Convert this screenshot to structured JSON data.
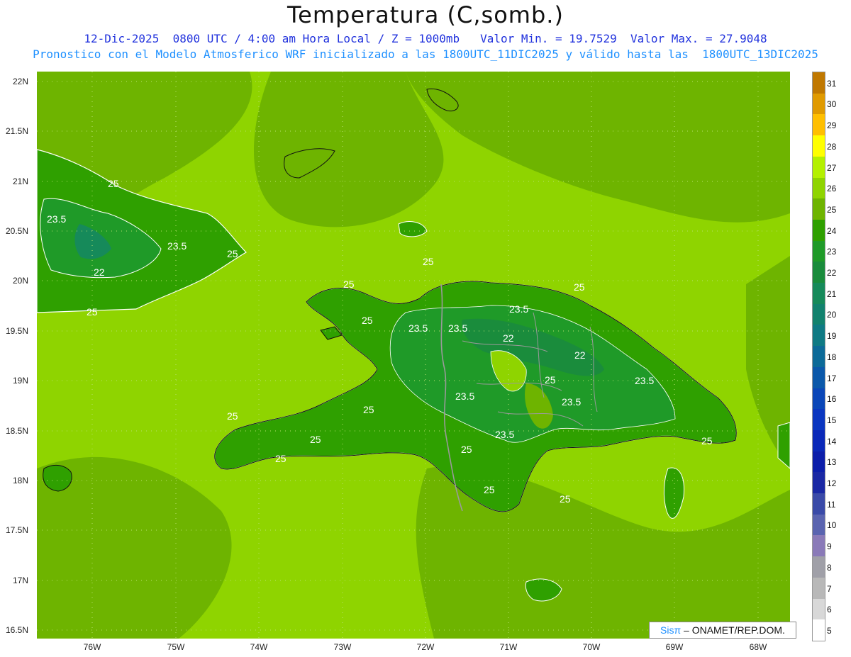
{
  "title": "Temperatura (C,somb.)",
  "subtitle1": "12-Dic-2025  0800 UTC / 4:00 am Hora Local / Z = 1000mb   Valor Min. = 19.7529  Valor Max. = 27.9048",
  "subtitle2": "Pronostico con el Modelo Atmosferico WRF inicializado a las 1800UTC_11DIC2025 y válido hasta las  1800UTC_13DIC2025",
  "lat_labels": [
    "22N",
    "21.5N",
    "21N",
    "20.5N",
    "20N",
    "19.5N",
    "19N",
    "18.5N",
    "18N",
    "17.5N",
    "17N",
    "16.5N"
  ],
  "lon_labels": [
    "76W",
    "75W",
    "74W",
    "73W",
    "72W",
    "71W",
    "70W",
    "69W",
    "68W"
  ],
  "colorbar": {
    "labels": [
      "31",
      "30",
      "29",
      "28",
      "27",
      "26",
      "25",
      "24",
      "23",
      "22",
      "21",
      "20",
      "19",
      "18",
      "17",
      "16",
      "15",
      "14",
      "13",
      "12",
      "11",
      "10",
      "9",
      "8",
      "7",
      "6",
      "5"
    ],
    "colors": [
      "#c07800",
      "#e09a00",
      "#ffbf00",
      "#ffff00",
      "#b4f000",
      "#8fd400",
      "#6eb400",
      "#2fa000",
      "#1f9a28",
      "#1a8c3c",
      "#168a5a",
      "#12826e",
      "#0f7a84",
      "#0c6a98",
      "#0b58aa",
      "#0a46b8",
      "#0a36c0",
      "#0a28b8",
      "#0c1eaa",
      "#1a28a4",
      "#3a4aa8",
      "#5a64b0",
      "#8a7ab8",
      "#a0a0a8",
      "#b8b8b8",
      "#d8d8d8",
      "#ffffff"
    ]
  },
  "contour_labels": [
    "25",
    "23.5",
    "22",
    "25",
    "23.5",
    "25",
    "25",
    "25",
    "23.5",
    "23.5",
    "22",
    "23.5",
    "22",
    "25",
    "25",
    "23.5",
    "25",
    "23.5",
    "23.5",
    "25",
    "25",
    "25",
    "23.5",
    "25",
    "25",
    "25",
    "25",
    "25"
  ],
  "credit": {
    "brand": "Sisπ",
    "text": " – ONAMET/REP.DOM."
  }
}
